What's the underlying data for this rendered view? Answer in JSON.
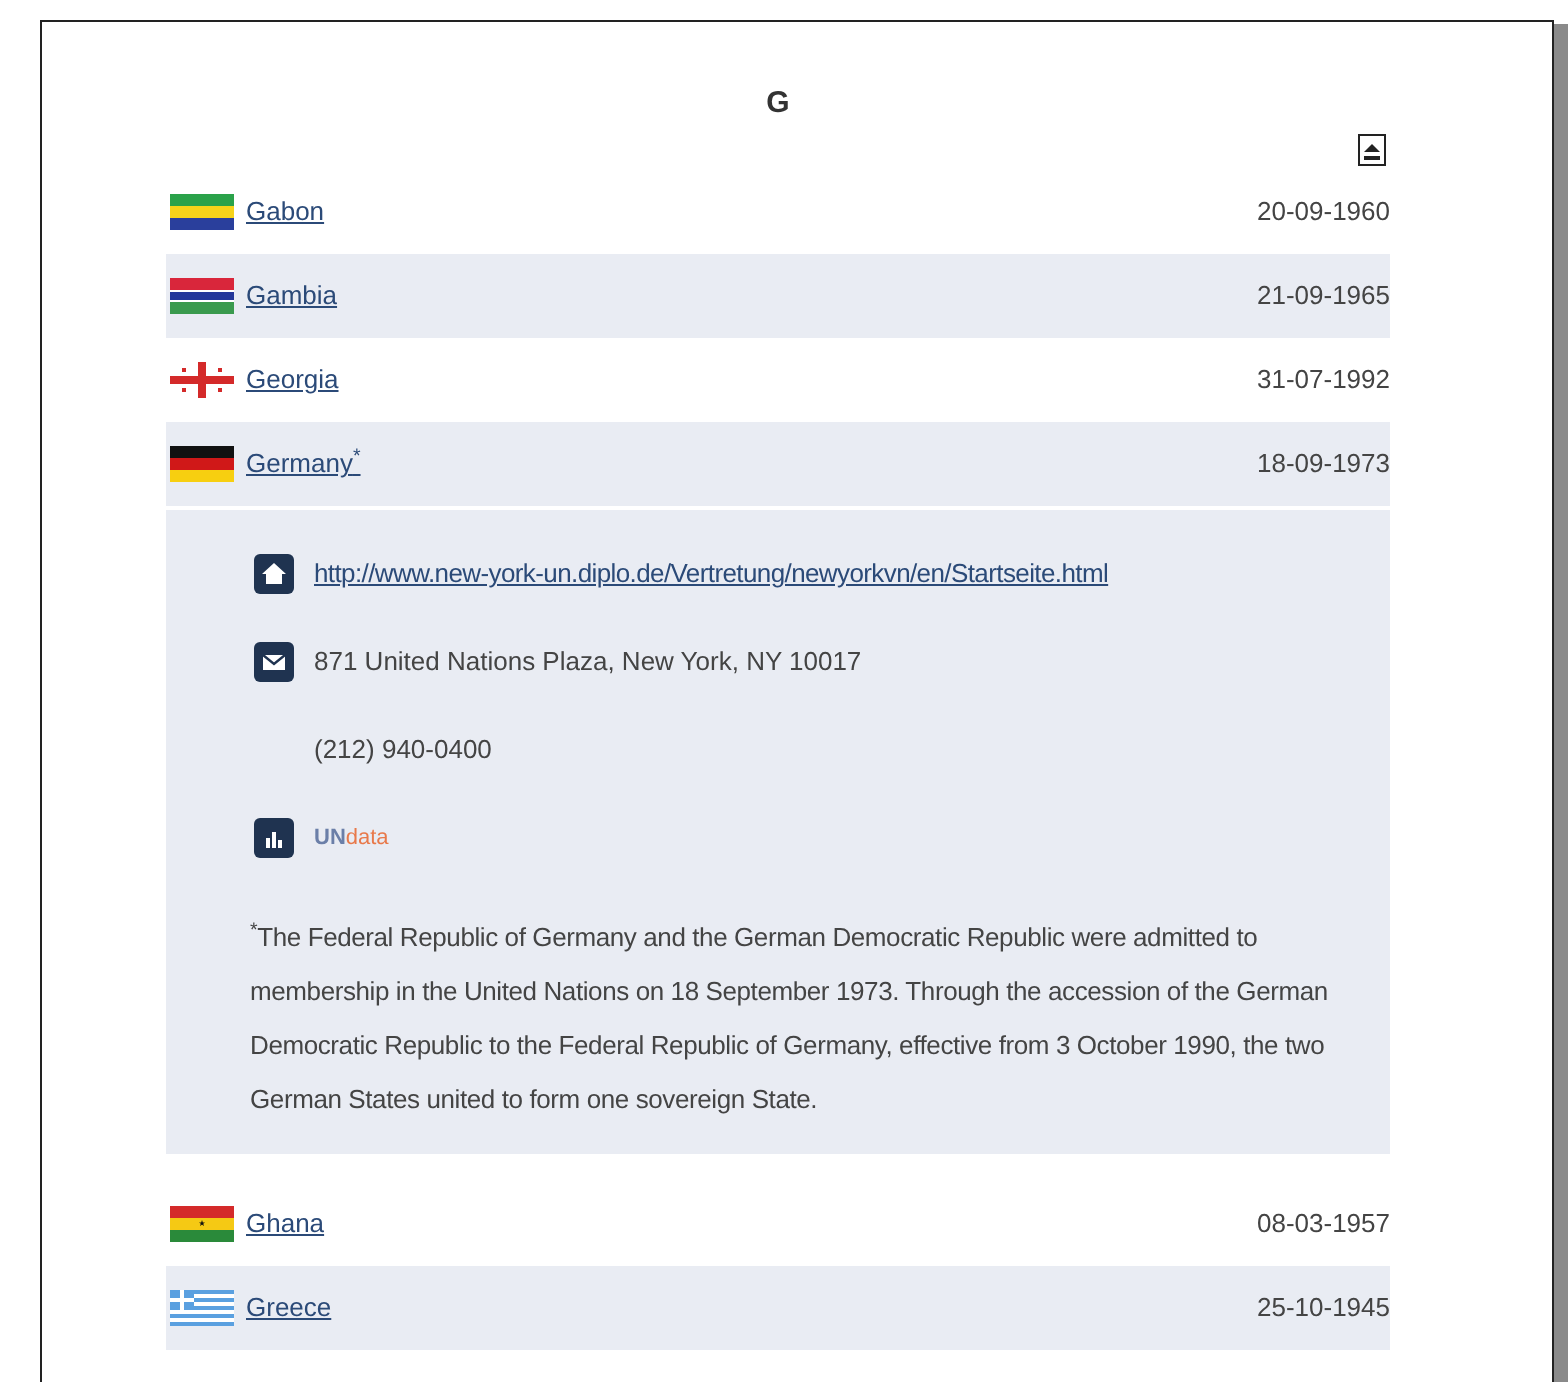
{
  "section": {
    "letter": "G"
  },
  "countries": [
    {
      "name": "Gabon",
      "date": "20-09-1960",
      "expanded": false
    },
    {
      "name": "Gambia",
      "date": "21-09-1965",
      "expanded": false
    },
    {
      "name": "Georgia",
      "date": "31-07-1992",
      "expanded": false
    },
    {
      "name": "Germany$^{*}$",
      "date": "18-09-1973",
      "expanded": true,
      "details": {
        "website": "http://www.new-york-un.diplo.de/Vertretung/newyorkvn/en/Startseite.html",
        "address": "871 United Nations Plaza, New York, NY 10017",
        "phone": "(212) 940-0400",
        "logo": [
          "UN",
          "data"
        ],
        "footnote": "$^{*}$The Federal Republic of Germany and the German Democratic Republic were admitted to membership in the United Nations on 18 September 1973. Through the accession of the German Democratic Republic to the Federal Republic of Germany, effective from 3 October 1990, the two German States united to form one sovereign State."
      }
    },
    {
      "name": "Ghana",
      "date": "08-03-1957",
      "expanded": false
    },
    {
      "name": "Greece",
      "date": "25-10-1945",
      "expanded": false
    }
  ]
}
